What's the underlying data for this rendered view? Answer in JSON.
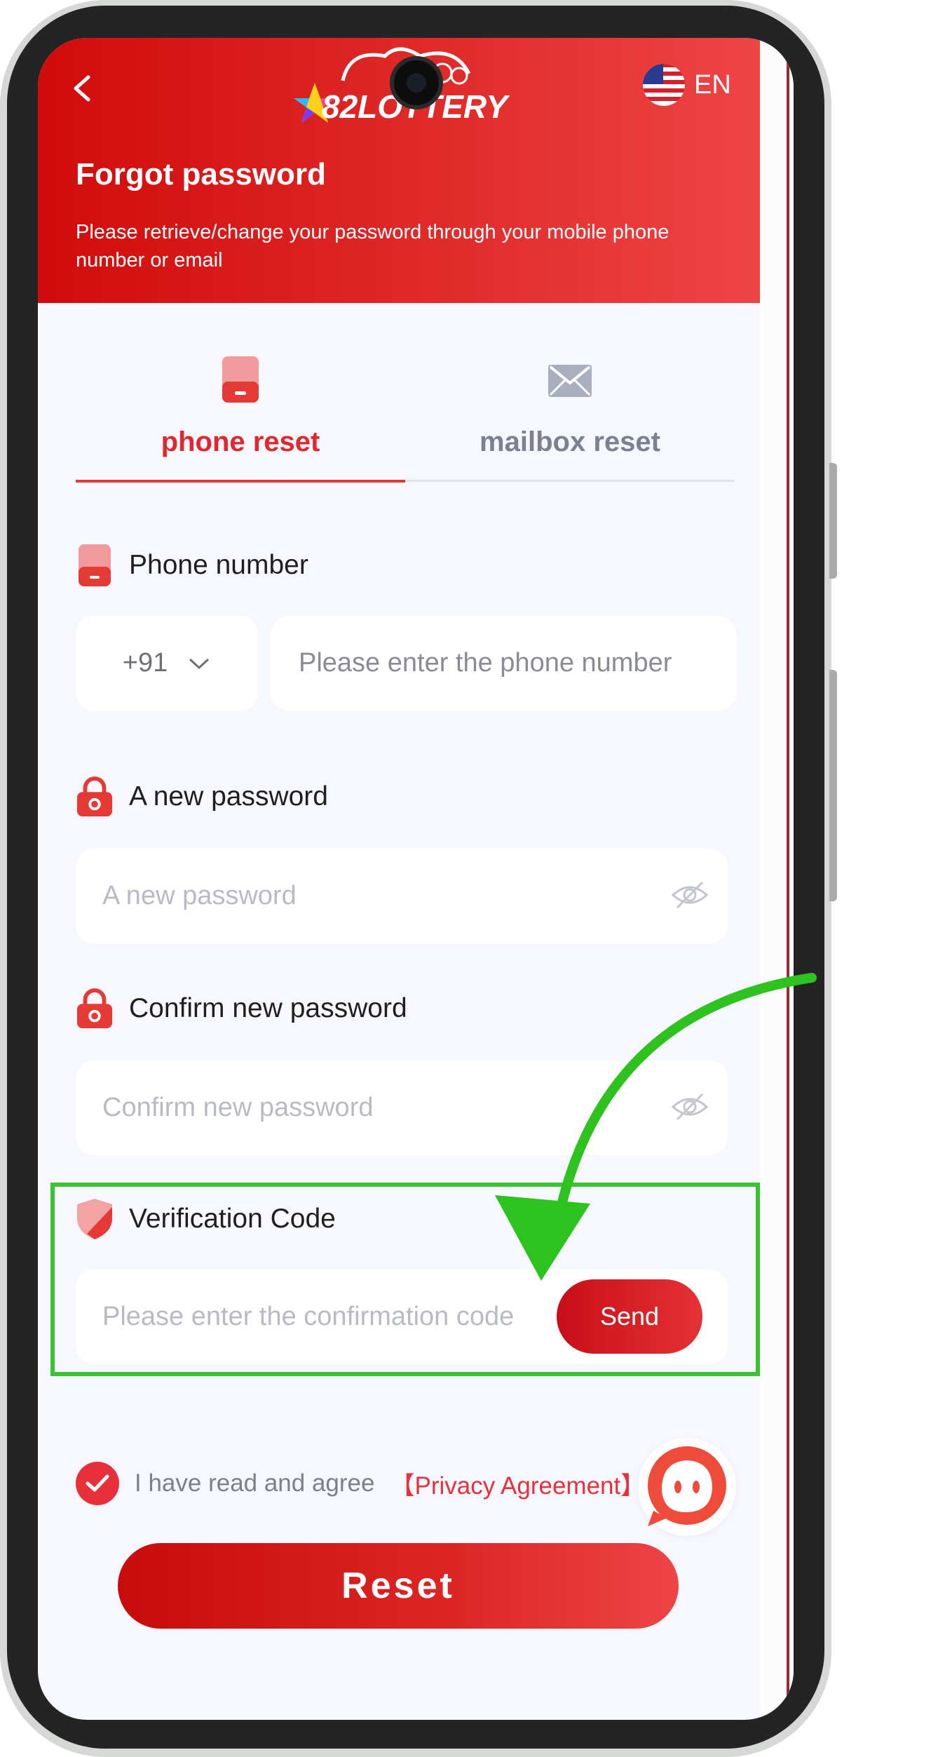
{
  "header": {
    "logo_text": "82LOTTERY",
    "language": "EN",
    "title": "Forgot password",
    "subtitle": "Please retrieve/change your password through your mobile phone number or email"
  },
  "tabs": [
    {
      "label": "phone reset",
      "active": true,
      "icon": "phone-icon"
    },
    {
      "label": "mailbox reset",
      "active": false,
      "icon": "mail-icon"
    }
  ],
  "form": {
    "phone": {
      "label": "Phone number",
      "country_code": "+91",
      "placeholder": "Please enter the phone number"
    },
    "new_password": {
      "label": "A new password",
      "placeholder": "A new password"
    },
    "confirm_password": {
      "label": "Confirm new password",
      "placeholder": "Confirm new password"
    },
    "verification": {
      "label": "Verification Code",
      "placeholder": "Please enter the confirmation code",
      "send_label": "Send"
    },
    "agreement": {
      "text": "I have read and agree",
      "link": "【Privacy Agreement】",
      "checked": true
    },
    "reset_label": "Reset"
  },
  "colors": {
    "primary": "#e0282c",
    "highlight": "#3cc234",
    "inactive_tab": "#7b8093",
    "background": "#f7f8ff"
  }
}
